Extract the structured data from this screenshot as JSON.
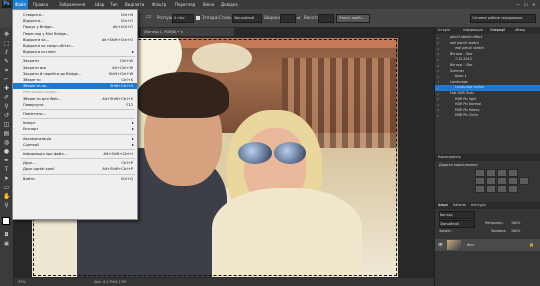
{
  "app": {
    "logo": "Ps"
  },
  "menubar": {
    "items": [
      "Файл",
      "Правка",
      "Зображення",
      "Шар",
      "Тип",
      "Виділити",
      "Фільтр",
      "Перегляд",
      "Вікно",
      "Довідка"
    ]
  },
  "options": {
    "feather_label": "Розтуш.:",
    "feather_value": "0 пікс",
    "antialias_label": "Згладж.",
    "style_label": "Стиль:",
    "style_value": "Звичайний",
    "width_label": "Ширина:",
    "height_label": "Висота:",
    "refine_button": "Уточн. край...",
    "workspace": "Основне робоче середовище"
  },
  "document": {
    "tab_title": "(Вигляд 1, RGB/8) *",
    "zoom": "33%",
    "doc_info": "Док: 8,17М/8,17М"
  },
  "file_menu": {
    "items": [
      {
        "label": "Створити...",
        "shortcut": "Ctrl+N",
        "disabled": false,
        "submenu": false
      },
      {
        "label": "Відкрити...",
        "shortcut": "Ctrl+O",
        "disabled": false,
        "submenu": false
      },
      {
        "label": "Пошук у Bridge...",
        "shortcut": "Alt+Ctrl+O",
        "disabled": false,
        "submenu": false
      },
      {
        "label": "Перегляд у Mini Bridge...",
        "shortcut": "",
        "disabled": false,
        "submenu": false
      },
      {
        "label": "Відкрити як...",
        "shortcut": "Alt+Shift+Ctrl+O",
        "disabled": false,
        "submenu": false
      },
      {
        "label": "Відкрити як смарт-об'єкт...",
        "shortcut": "",
        "disabled": false,
        "submenu": false
      },
      {
        "label": "Відкрити останні",
        "shortcut": "",
        "disabled": false,
        "submenu": true
      },
      {
        "sep": true
      },
      {
        "label": "Закрити",
        "shortcut": "Ctrl+W",
        "disabled": false,
        "submenu": false
      },
      {
        "label": "Закрити все",
        "shortcut": "Alt+Ctrl+W",
        "disabled": false,
        "submenu": false
      },
      {
        "label": "Закрити й перейти до Bridge...",
        "shortcut": "Shift+Ctrl+W",
        "disabled": false,
        "submenu": false
      },
      {
        "label": "Зберегти",
        "shortcut": "Ctrl+S",
        "disabled": false,
        "submenu": false
      },
      {
        "label": "Зберегти як...",
        "shortcut": "Shift+Ctrl+S",
        "disabled": false,
        "submenu": false,
        "selected": true
      },
      {
        "label": "Реєстрація входу...",
        "shortcut": "",
        "disabled": true,
        "submenu": false
      },
      {
        "label": "Зберегти для Web...",
        "shortcut": "Alt+Shift+Ctrl+S",
        "disabled": false,
        "submenu": false
      },
      {
        "label": "Повернути",
        "shortcut": "F12",
        "disabled": false,
        "submenu": false
      },
      {
        "sep": true
      },
      {
        "label": "Помістити...",
        "shortcut": "",
        "disabled": false,
        "submenu": false
      },
      {
        "sep": true
      },
      {
        "label": "Імпорт",
        "shortcut": "",
        "disabled": false,
        "submenu": true
      },
      {
        "label": "Експорт",
        "shortcut": "",
        "disabled": false,
        "submenu": true
      },
      {
        "sep": true
      },
      {
        "label": "Автоматизація",
        "shortcut": "",
        "disabled": false,
        "submenu": true
      },
      {
        "label": "Сценарії",
        "shortcut": "",
        "disabled": false,
        "submenu": true
      },
      {
        "sep": true
      },
      {
        "label": "Інформація про файл...",
        "shortcut": "Alt+Shift+Ctrl+I",
        "disabled": false,
        "submenu": false
      },
      {
        "sep": true
      },
      {
        "label": "Друк...",
        "shortcut": "Ctrl+P",
        "disabled": false,
        "submenu": false
      },
      {
        "label": "Друк однієї копії",
        "shortcut": "Alt+Shift+Ctrl+P",
        "disabled": false,
        "submenu": false
      },
      {
        "sep": true
      },
      {
        "label": "Вийти",
        "shortcut": "Ctrl+Q",
        "disabled": false,
        "submenu": false
      }
    ]
  },
  "panels": {
    "top_tabs": [
      "Історія",
      "Інформація",
      "Операції",
      "Абзац"
    ],
    "actions": [
      {
        "label": "pencil sketch effect",
        "indent": 1
      },
      {
        "label": "real pencil sketch",
        "indent": 1
      },
      {
        "label": "real pencil sketch",
        "indent": 2
      },
      {
        "label": "Вінтаж – Stor",
        "indent": 1
      },
      {
        "label": "7.12.2013",
        "indent": 2
      },
      {
        "label": "Вінтаж – Stor",
        "indent": 1
      },
      {
        "label": "Summer",
        "indent": 1
      },
      {
        "label": "Крок 1",
        "indent": 2
      },
      {
        "label": "Landscape",
        "indent": 1
      },
      {
        "label": "Landscape action",
        "indent": 2
      },
      {
        "label": "Faik HDR Tools",
        "indent": 1
      },
      {
        "label": "HDR Pic light",
        "indent": 2
      },
      {
        "label": "HDR Pic Normal",
        "indent": 2
      },
      {
        "label": "HDR Pic Heavy",
        "indent": 2
      },
      {
        "label": "HDR Pic Clickr",
        "indent": 2
      }
    ],
    "adjustments_tab": "Коригування",
    "adjustments_title": "Додати коригування",
    "layers_tabs": [
      "Шари",
      "Канали",
      "Контури"
    ],
    "layers_kind": "Вигляд",
    "layers_mode": "Звичайний",
    "opacity_label": "Непрозор.:",
    "opacity_value": "100%",
    "lock_label": "Закріп.:",
    "fill_label": "Заливка:",
    "fill_value": "100%",
    "layer_name": "Фон"
  },
  "colors": {
    "menu_highlight": "#1e78d2",
    "panel_bg": "#353535",
    "menu_bg": "#efefef"
  }
}
